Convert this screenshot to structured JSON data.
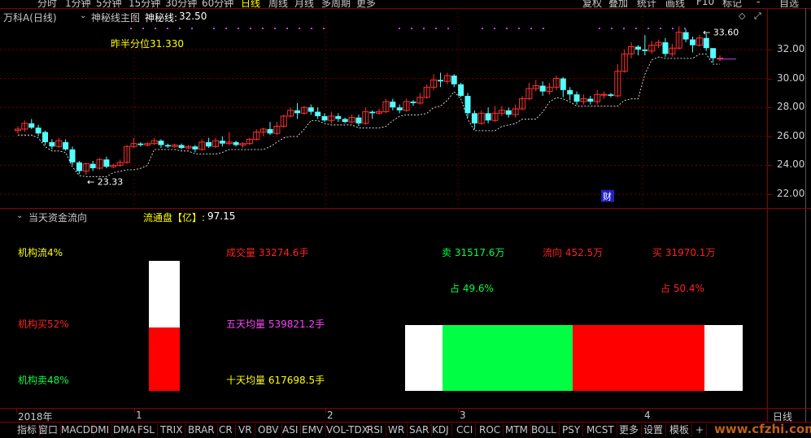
{
  "toolbar": {
    "periods": [
      "分时",
      "1分钟",
      "5分钟",
      "15分钟",
      "30分钟",
      "60分钟",
      "日线",
      "周线",
      "月线",
      "多周期",
      "更多"
    ],
    "active_period": "日线",
    "right_buttons": [
      "复权",
      "叠加",
      "统计",
      "画线",
      "F10",
      "标记",
      "-",
      "自选"
    ]
  },
  "header": {
    "stock": "万科A(日线)",
    "indicator_name": "神秘线主图",
    "indicator_label": "神秘线:",
    "indicator_value": "32.50",
    "prev_half_label": "昨半分位31.330"
  },
  "chart_data": {
    "type": "candlestick",
    "y_ticks": [
      "32.00",
      "30.00",
      "28.00",
      "26.00",
      "24.00",
      "22.00"
    ],
    "ylim": [
      21.0,
      34.0
    ],
    "x_ticks": [
      "2018年",
      "1",
      "2",
      "3",
      "4"
    ],
    "annotations": [
      {
        "text": "33.60",
        "kind": "high"
      },
      {
        "text": "23.33",
        "kind": "low"
      },
      {
        "text": "财",
        "kind": "event"
      }
    ],
    "candles": [
      [
        26.4,
        26.5,
        26.2,
        26.7
      ],
      [
        26.5,
        26.9,
        26.3,
        27.1
      ],
      [
        26.9,
        26.6,
        26.5,
        27.2
      ],
      [
        26.6,
        26.2,
        26.0,
        26.8
      ],
      [
        26.3,
        25.6,
        25.4,
        26.4
      ],
      [
        25.6,
        25.3,
        25.1,
        25.8
      ],
      [
        25.3,
        25.7,
        25.2,
        25.9
      ],
      [
        25.6,
        25.1,
        25.0,
        25.8
      ],
      [
        25.1,
        24.2,
        24.0,
        25.3
      ],
      [
        24.2,
        23.6,
        23.4,
        24.3
      ],
      [
        23.6,
        24.1,
        23.33,
        24.2
      ],
      [
        24.1,
        23.8,
        23.6,
        24.3
      ],
      [
        23.8,
        24.4,
        23.7,
        24.5
      ],
      [
        24.4,
        23.9,
        23.8,
        24.6
      ],
      [
        23.9,
        24.0,
        23.8,
        24.1
      ],
      [
        24.0,
        24.2,
        23.9,
        24.4
      ],
      [
        24.2,
        25.3,
        24.1,
        25.4
      ],
      [
        25.3,
        25.5,
        25.2,
        25.9
      ],
      [
        25.5,
        25.4,
        25.3,
        25.6
      ],
      [
        25.4,
        25.5,
        25.3,
        25.6
      ],
      [
        25.5,
        25.7,
        25.4,
        25.9
      ],
      [
        25.7,
        25.4,
        25.2,
        25.8
      ],
      [
        25.4,
        25.3,
        25.2,
        25.5
      ],
      [
        25.3,
        25.4,
        25.2,
        25.5
      ],
      [
        25.4,
        25.2,
        25.1,
        25.5
      ],
      [
        25.2,
        25.3,
        25.1,
        25.4
      ],
      [
        25.3,
        25.1,
        24.9,
        25.4
      ],
      [
        25.1,
        25.6,
        25.0,
        25.8
      ],
      [
        25.6,
        25.3,
        25.2,
        25.9
      ],
      [
        25.3,
        25.7,
        25.2,
        25.9
      ],
      [
        25.7,
        25.5,
        25.3,
        26.0
      ],
      [
        25.5,
        25.6,
        25.4,
        26.3
      ],
      [
        25.6,
        25.4,
        25.3,
        25.7
      ],
      [
        25.4,
        25.5,
        25.2,
        25.6
      ],
      [
        25.5,
        25.8,
        25.4,
        25.9
      ],
      [
        25.8,
        26.3,
        25.7,
        26.5
      ],
      [
        26.3,
        26.5,
        26.0,
        26.6
      ],
      [
        26.5,
        26.2,
        26.1,
        27.0
      ],
      [
        26.2,
        26.7,
        26.1,
        27.0
      ],
      [
        26.7,
        27.4,
        26.6,
        27.5
      ],
      [
        27.4,
        27.8,
        27.3,
        28.0
      ],
      [
        27.8,
        27.6,
        27.2,
        28.3
      ],
      [
        27.6,
        28.0,
        27.5,
        28.1
      ],
      [
        28.0,
        27.7,
        27.5,
        28.2
      ],
      [
        27.7,
        27.4,
        27.2,
        28.0
      ],
      [
        27.4,
        27.1,
        27.0,
        27.6
      ],
      [
        27.1,
        27.4,
        26.9,
        27.7
      ],
      [
        27.4,
        27.2,
        27.0,
        27.6
      ],
      [
        27.2,
        27.0,
        26.9,
        27.3
      ],
      [
        27.0,
        27.3,
        26.9,
        27.5
      ],
      [
        27.3,
        26.9,
        26.7,
        27.5
      ],
      [
        26.9,
        27.7,
        26.8,
        28.0
      ],
      [
        27.7,
        27.6,
        27.2,
        27.8
      ],
      [
        27.6,
        27.7,
        27.5,
        27.9
      ],
      [
        27.7,
        28.4,
        27.6,
        28.6
      ],
      [
        28.4,
        28.0,
        27.8,
        28.6
      ],
      [
        28.0,
        27.8,
        27.6,
        28.2
      ],
      [
        27.8,
        28.4,
        27.7,
        28.6
      ],
      [
        28.4,
        28.3,
        28.1,
        28.5
      ],
      [
        28.3,
        28.7,
        28.2,
        29.0
      ],
      [
        28.7,
        29.4,
        28.6,
        29.6
      ],
      [
        29.4,
        29.9,
        29.2,
        30.3
      ],
      [
        29.9,
        29.8,
        29.4,
        30.4
      ],
      [
        29.8,
        30.2,
        29.6,
        30.4
      ],
      [
        30.2,
        29.6,
        29.4,
        30.3
      ],
      [
        29.6,
        28.8,
        28.7,
        29.7
      ],
      [
        28.8,
        27.6,
        27.3,
        29.0
      ],
      [
        27.6,
        26.9,
        26.5,
        27.8
      ],
      [
        26.9,
        27.6,
        26.8,
        27.8
      ],
      [
        27.6,
        27.1,
        26.9,
        28.0
      ],
      [
        27.1,
        27.6,
        27.0,
        28.1
      ],
      [
        27.6,
        27.8,
        27.4,
        28.1
      ],
      [
        27.8,
        27.5,
        27.3,
        28.0
      ],
      [
        27.5,
        27.9,
        27.3,
        28.2
      ],
      [
        27.9,
        28.6,
        27.8,
        28.8
      ],
      [
        28.6,
        29.3,
        28.5,
        29.7
      ],
      [
        29.3,
        29.5,
        29.1,
        29.9
      ],
      [
        29.5,
        29.1,
        28.8,
        29.8
      ],
      [
        29.1,
        29.4,
        28.9,
        29.7
      ],
      [
        29.4,
        30.0,
        29.2,
        30.2
      ],
      [
        30.0,
        29.2,
        28.7,
        30.1
      ],
      [
        29.2,
        28.9,
        28.5,
        29.4
      ],
      [
        28.9,
        28.4,
        28.2,
        29.1
      ],
      [
        28.4,
        28.6,
        28.2,
        28.9
      ],
      [
        28.6,
        28.4,
        28.2,
        28.8
      ],
      [
        28.4,
        28.9,
        28.2,
        29.2
      ],
      [
        28.9,
        28.9,
        28.6,
        29.1
      ],
      [
        28.9,
        28.8,
        28.7,
        29.0
      ],
      [
        28.8,
        30.5,
        28.7,
        31.0
      ],
      [
        30.5,
        31.7,
        30.4,
        32.0
      ],
      [
        31.7,
        32.2,
        31.4,
        32.5
      ],
      [
        32.2,
        32.0,
        31.6,
        32.3
      ],
      [
        32.0,
        31.9,
        31.6,
        33.0
      ],
      [
        31.9,
        32.3,
        31.7,
        32.6
      ],
      [
        32.3,
        32.5,
        32.1,
        32.7
      ],
      [
        32.5,
        31.7,
        31.5,
        32.8
      ],
      [
        31.7,
        32.1,
        31.5,
        32.4
      ],
      [
        32.1,
        33.2,
        32.0,
        33.6
      ],
      [
        33.2,
        32.7,
        32.5,
        33.4
      ],
      [
        32.7,
        32.3,
        31.8,
        32.9
      ],
      [
        32.3,
        32.8,
        32.2,
        33.0
      ],
      [
        32.8,
        32.1,
        31.9,
        33.1
      ],
      [
        32.1,
        31.4,
        31.1,
        32.0
      ],
      [
        31.4,
        31.4,
        31.2,
        31.6
      ]
    ]
  },
  "funds": {
    "panel_title": "当天资金流向",
    "float_label": "流通盘【亿】:",
    "float_value": "97.15",
    "inst_flow": "机构流4%",
    "inst_buy": "机构买52%",
    "inst_sell": "机构卖48%",
    "volume": "成交量 33274.6手",
    "avg5": "五天均量 539821.2手",
    "avg10": "十天均量 617698.5手",
    "sell": "卖 31517.6万",
    "flow": "流向 452.5万",
    "buy": "买 31970.1万",
    "sell_pct": "占 49.6%",
    "buy_pct": "占 50.4%",
    "inst_buy_fraction": 0.52,
    "sell_fraction": 0.496,
    "buy_fraction": 0.504,
    "colors": {
      "buy": "#ff0000",
      "sell": "#00ff44",
      "neutral": "#ffffff"
    }
  },
  "right_panel": {
    "daily_label": "日线"
  },
  "tabs": [
    "指标",
    "窗口",
    "MACD",
    "DMI",
    "DMA",
    "FSL",
    "TRIX",
    "BRAR",
    "CR",
    "VR",
    "OBV",
    "ASI",
    "EMV",
    "VOL-TDX",
    "RSI",
    "WR",
    "SAR",
    "KDJ",
    "CCI",
    "ROC",
    "MTM",
    "BOLL",
    "PSY",
    "MCST",
    "更多",
    "设置",
    "模板",
    "+"
  ],
  "watermark": "www.cfzhi.com"
}
